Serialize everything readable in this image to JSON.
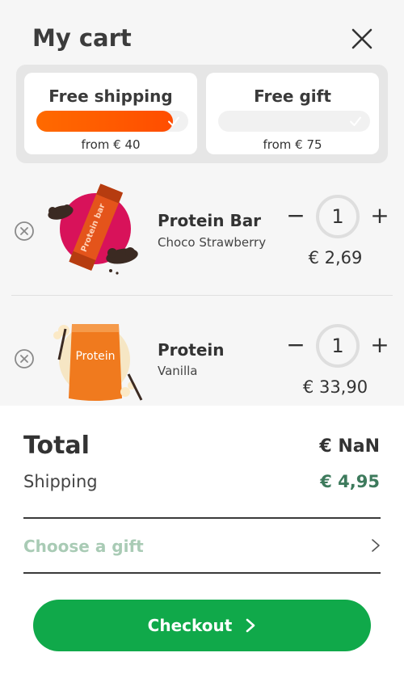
{
  "header": {
    "title": "My cart"
  },
  "promos": [
    {
      "title": "Free shipping",
      "subtitle": "from € 40",
      "progress": 0.9
    },
    {
      "title": "Free gift",
      "subtitle": "from € 75",
      "progress": 0
    }
  ],
  "items": [
    {
      "name": "Protein Bar",
      "variant": "Choco Strawberry",
      "quantity": "1",
      "price": "€ 2,69",
      "minus_label": "−",
      "plus_label": "+",
      "image_text": "Protein bar"
    },
    {
      "name": "Protein",
      "variant": "Vanilla",
      "quantity": "1",
      "price": "€ 33,90",
      "minus_label": "−",
      "plus_label": "+",
      "image_text": "Protein"
    }
  ],
  "summary": {
    "total_label": "Total",
    "total_value": "€ NaN",
    "shipping_label": "Shipping",
    "shipping_value": "€ 4,95"
  },
  "gift": {
    "label": "Choose a gift"
  },
  "checkout": {
    "label": "Checkout"
  },
  "colors": {
    "accent_orange": "#ff5a00",
    "checkout_green": "#10a94a",
    "shipping_green": "#3d7a5c",
    "gift_label_green": "#a9cbb5"
  }
}
